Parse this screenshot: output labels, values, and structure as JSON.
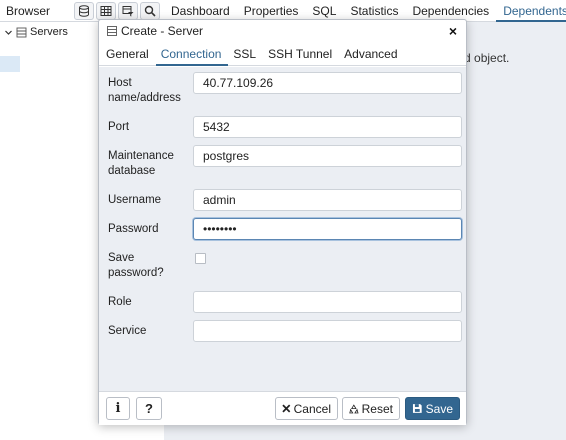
{
  "app": {
    "browser_label": "Browser",
    "tabs": [
      "Dashboard",
      "Properties",
      "SQL",
      "Statistics",
      "Dependencies",
      "Dependents"
    ],
    "active_tab": "Dependents",
    "tree_root": "Servers",
    "main_message": "ted object."
  },
  "dialog": {
    "title": "Create - Server",
    "close_glyph": "×",
    "tabs": [
      "General",
      "Connection",
      "SSL",
      "SSH Tunnel",
      "Advanced"
    ],
    "active_tab": "Connection",
    "fields": {
      "host_label_line1": "Host",
      "host_label_line2": "name/address",
      "host_value": "40.77.109.26",
      "port_label": "Port",
      "port_value": "5432",
      "maint_label_line1": "Maintenance",
      "maint_label_line2": "database",
      "maint_value": "postgres",
      "username_label": "Username",
      "username_value": "admin",
      "password_label": "Password",
      "password_value": "xxxxxxxx",
      "save_label_line1": "Save",
      "save_label_line2": "password?",
      "role_label": "Role",
      "role_value": "",
      "service_label": "Service",
      "service_value": ""
    },
    "footer": {
      "info_glyph": "i",
      "help_glyph": "?",
      "cancel_label": "Cancel",
      "reset_label": "Reset",
      "save_label": "Save"
    }
  },
  "colors": {
    "accent": "#326690",
    "panel_bg": "#ebeef3"
  }
}
